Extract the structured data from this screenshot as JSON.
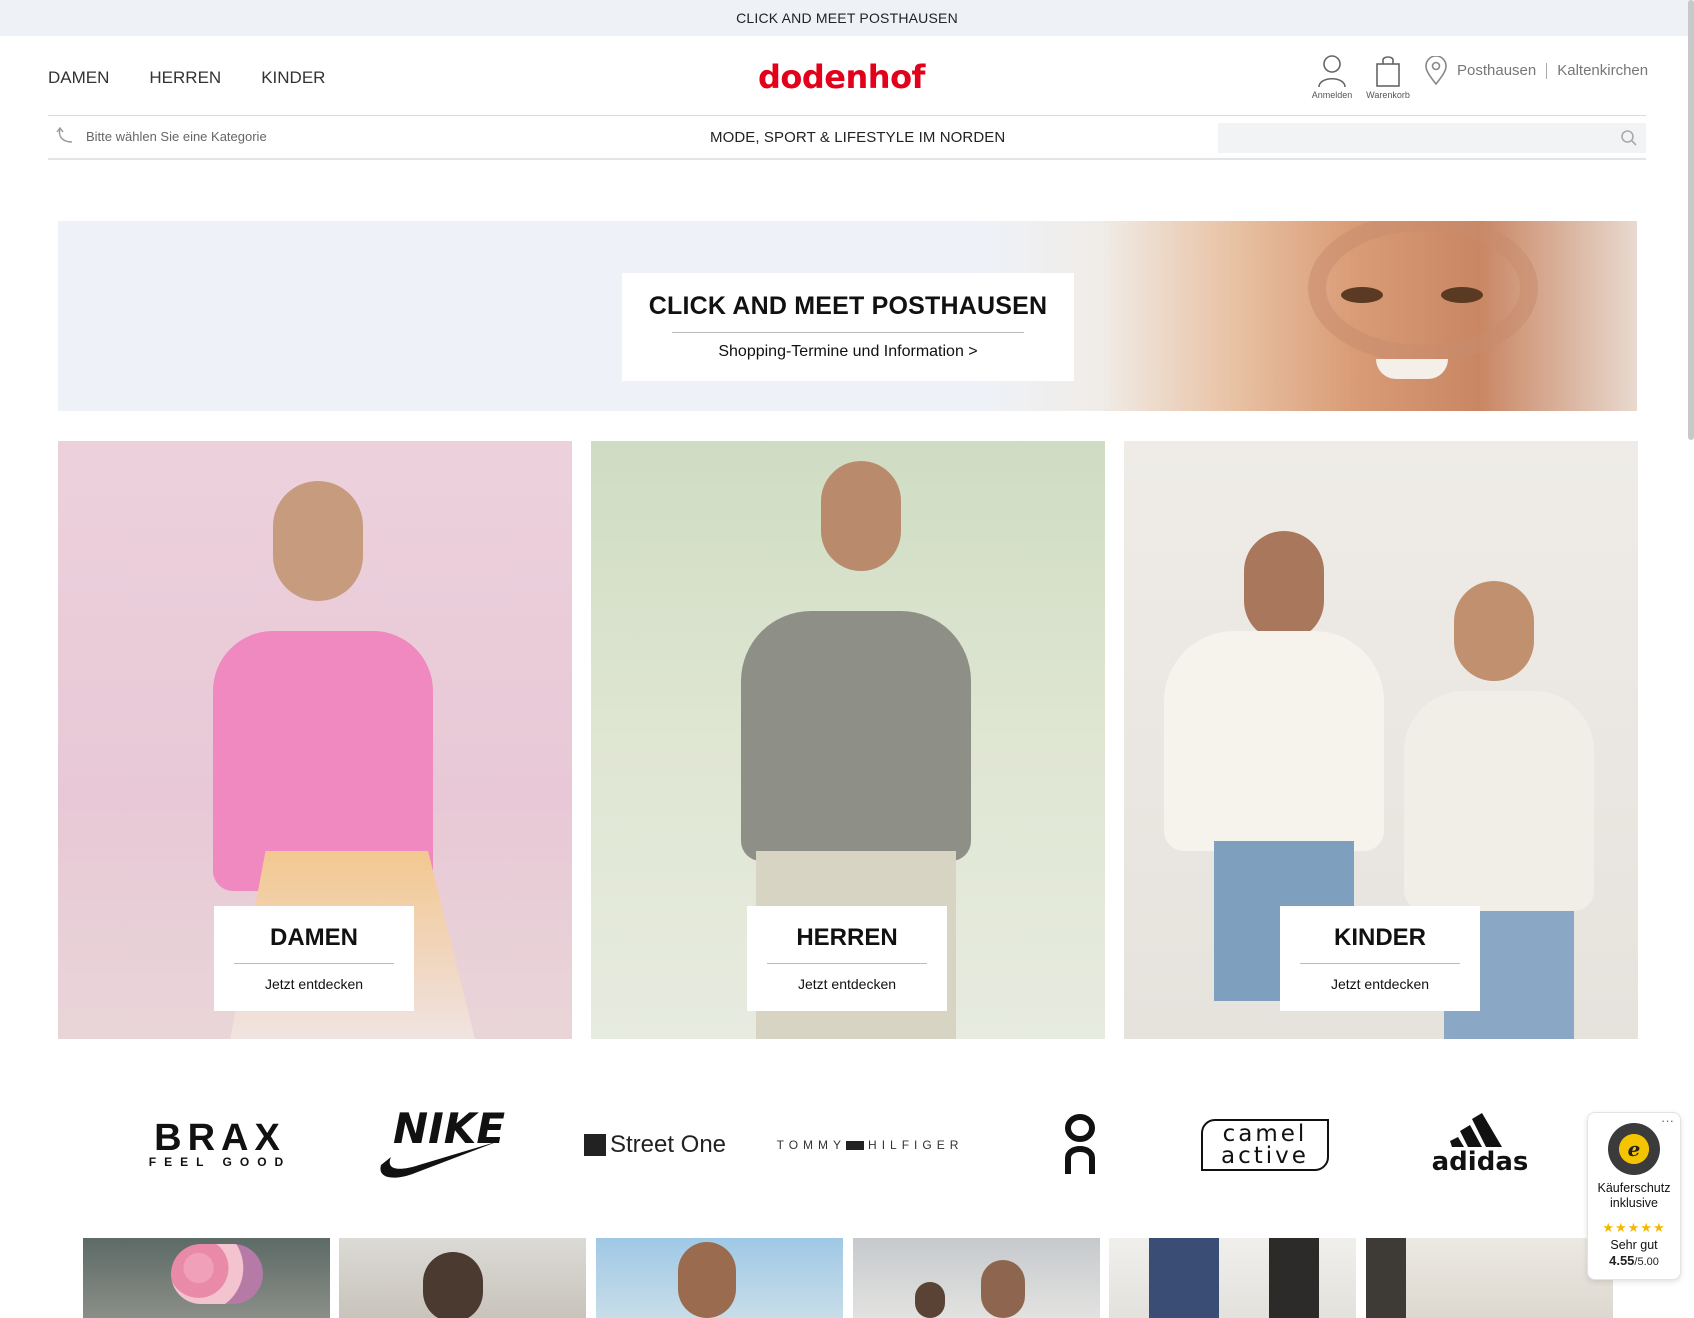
{
  "topbar": {
    "text": "CLICK AND MEET POSTHAUSEN"
  },
  "header": {
    "nav": [
      "DAMEN",
      "HERREN",
      "KINDER"
    ],
    "logo": "dodenhof",
    "account_label": "Anmelden",
    "cart_label": "Warenkorb",
    "store_primary": "Posthausen",
    "store_secondary": "Kaltenkirchen"
  },
  "subbar": {
    "category_placeholder": "Bitte wählen Sie eine Kategorie",
    "tagline": "MODE, SPORT & LIFESTYLE IM NORDEN",
    "search_value": ""
  },
  "hero": {
    "title": "CLICK AND MEET POSTHAUSEN",
    "subtitle": "Shopping-Termine und Information >"
  },
  "categories": [
    {
      "title": "DAMEN",
      "cta": "Jetzt entdecken"
    },
    {
      "title": "HERREN",
      "cta": "Jetzt entdecken"
    },
    {
      "title": "KINDER",
      "cta": "Jetzt entdecken"
    }
  ],
  "brands": {
    "brax": {
      "name": "BRAX",
      "tagline": "FEEL GOOD"
    },
    "nike": "NIKE",
    "streetone": "Street One",
    "tommy": {
      "left": "TOMMY",
      "right": "HILFIGER"
    },
    "on": "On",
    "camel": {
      "line1": "camel",
      "line2": "active"
    },
    "adidas": "adidas"
  },
  "trust": {
    "more": "···",
    "seal_letter": "e",
    "line1": "Käuferschutz",
    "line2": "inklusive",
    "stars": "★★★★★",
    "rating_text": "Sehr gut",
    "score": "4.55",
    "score_max": "/5.00"
  },
  "colors": {
    "brand_red": "#e2001a",
    "topbar_bg": "#eef2f7",
    "star": "#f5b800"
  }
}
